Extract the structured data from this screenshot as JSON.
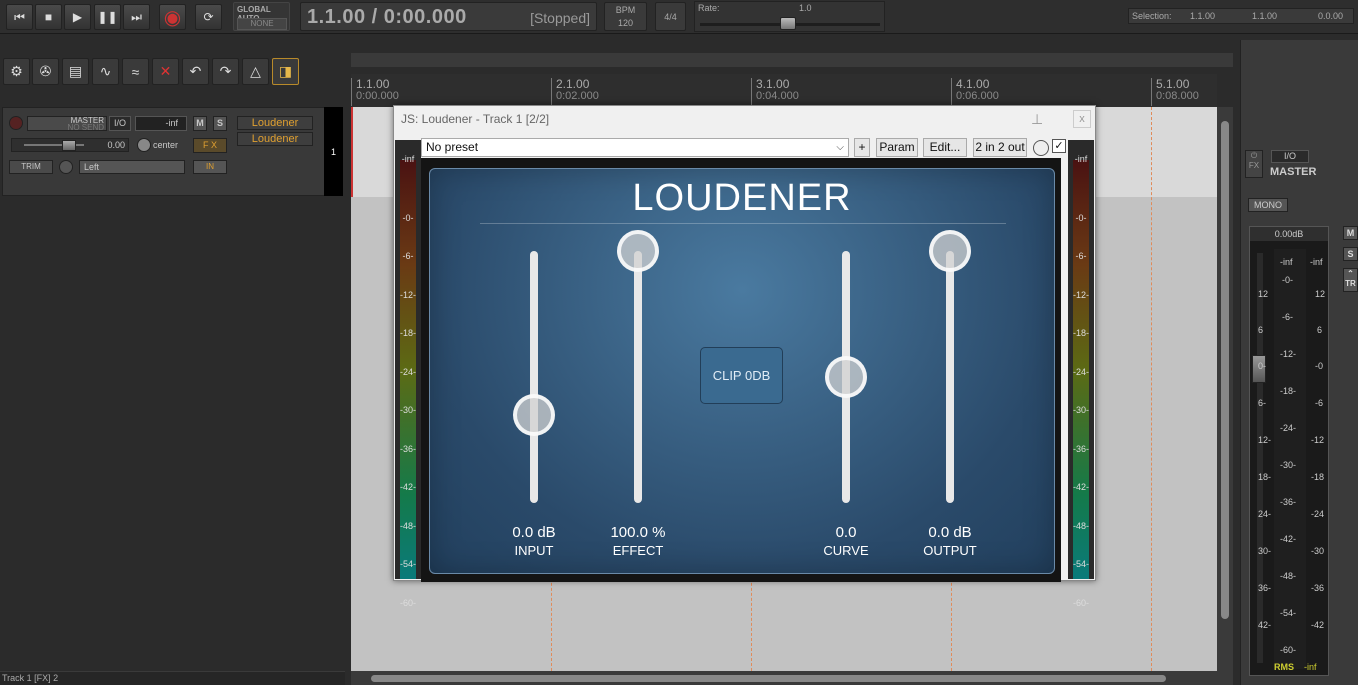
{
  "transport": {
    "buttons": [
      "go-to-start",
      "stop",
      "play",
      "pause",
      "go-to-end",
      "record",
      "repeat"
    ],
    "global_auto_label": "GLOBAL AUTO",
    "global_auto_value": "NONE",
    "position": "1.1.00 / 0:00.000",
    "state": "[Stopped]",
    "bpm_label": "BPM",
    "bpm_value": "120",
    "time_signature": "4/4",
    "rate_label": "Rate:",
    "rate_value": "1.0",
    "selection_label": "Selection:",
    "selection_start": "1.1.00",
    "selection_end": "1.1.00",
    "selection_length": "0.0.00"
  },
  "track": {
    "name": "MASTER",
    "name2": "NO SEND",
    "io": "I/O",
    "volume_readout": "-inf",
    "mute": "M",
    "solo": "S",
    "fx1": "Loudener",
    "fx2": "Loudener",
    "volume_db": "0.00",
    "pan": "center",
    "fx_label": "F X",
    "trim": "TRIM",
    "input": "Left",
    "in_label": "IN",
    "number": "1"
  },
  "ruler": [
    {
      "bar": "1.1.00",
      "time": "0:00.000"
    },
    {
      "bar": "2.1.00",
      "time": "0:02.000"
    },
    {
      "bar": "3.1.00",
      "time": "0:04.000"
    },
    {
      "bar": "4.1.00",
      "time": "0:06.000"
    },
    {
      "bar": "5.1.00",
      "time": "0:08.000"
    }
  ],
  "status_bar": "Track 1 [FX] 2",
  "plugin": {
    "window_title": "JS: Loudener - Track 1 [2/2]",
    "close": "x",
    "preset": "No preset",
    "buttons": {
      "add": "+",
      "param": "Param",
      "edit": "Edit...",
      "io": "2 in 2 out"
    },
    "title": "LOUDENER",
    "clip_button": "CLIP 0DB",
    "sliders": [
      {
        "label": "INPUT",
        "value": "0.0 dB",
        "level": 0.35
      },
      {
        "label": "EFFECT",
        "value": "100.0 %",
        "level": 1.0
      },
      {
        "label": "CURVE",
        "value": "0.0",
        "level": 0.5
      },
      {
        "label": "OUTPUT",
        "value": "0.0 dB",
        "level": 1.0
      }
    ],
    "meter_scale": [
      "-inf",
      "-0-",
      "-6-",
      "-12-",
      "-18-",
      "-24-",
      "-30-",
      "-36-",
      "-42-",
      "-48-",
      "-54-",
      "-60-"
    ]
  },
  "master": {
    "label": "MASTER",
    "io": "I/O",
    "fx": "FX",
    "mono": "MONO",
    "peak": "0.00dB",
    "mute": "M",
    "solo": "S",
    "trim": "TR",
    "left_scale": [
      "12",
      "6",
      "0-",
      "6-",
      "12-",
      "18-",
      "24-",
      "30-",
      "36-",
      "42-"
    ],
    "center_scale": [
      "-inf",
      "-0-",
      "-6-",
      "-12-",
      "-18-",
      "-24-",
      "-30-",
      "-36-",
      "-42-",
      "-48-",
      "-54-",
      "-60-"
    ],
    "right_top": "-inf",
    "right_scale": [
      "12",
      "6",
      "-0",
      "-6",
      "-12",
      "-18",
      "-24",
      "-30",
      "-36",
      "-42"
    ],
    "rms_label": "RMS",
    "rms_value": "-inf"
  }
}
